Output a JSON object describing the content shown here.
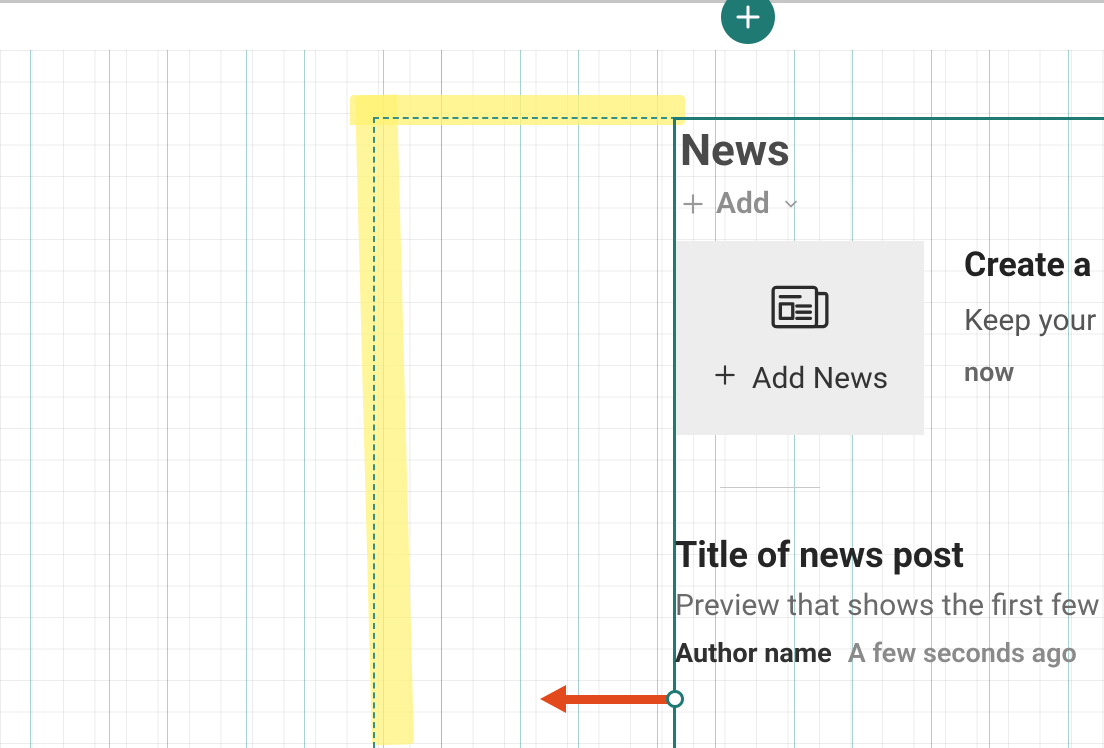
{
  "webpart": {
    "title": "News",
    "add_menu_label": "Add"
  },
  "news_tile": {
    "cta_label": "Add News"
  },
  "side": {
    "heading": "Create a",
    "subheading": "Keep your",
    "timestamp": "now"
  },
  "post": {
    "title": "Title of news post",
    "preview": "Preview that shows the first few li",
    "author": "Author name",
    "time": "A few seconds ago"
  },
  "colors": {
    "accent": "#1f7a74",
    "highlight": "#f6ef6b",
    "arrow": "#e24a1e"
  }
}
